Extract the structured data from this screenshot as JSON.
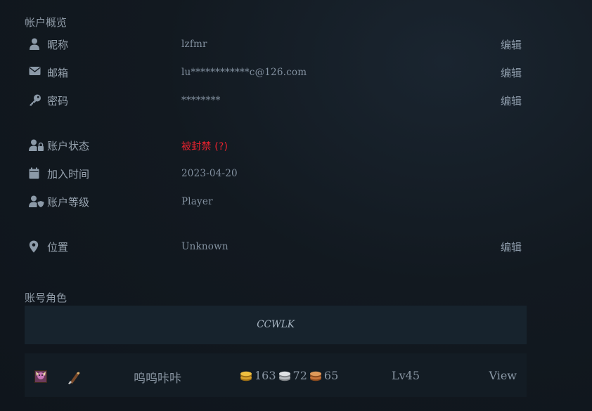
{
  "overview": {
    "title": "帐户概览",
    "rows": {
      "nickname": {
        "label": "昵称",
        "value": "lzfmr",
        "edit": "编辑"
      },
      "email": {
        "label": "邮箱",
        "value": "lu************c@126.com",
        "edit": "编辑"
      },
      "password": {
        "label": "密码",
        "value": "********",
        "edit": "编辑"
      },
      "status": {
        "label": "账户状态",
        "value": "被封禁 (?)"
      },
      "joined": {
        "label": "加入时间",
        "value": "2023-04-20"
      },
      "level": {
        "label": "账户等级",
        "value": "Player"
      },
      "location": {
        "label": "位置",
        "value": "Unknown",
        "edit": "编辑"
      }
    }
  },
  "characters": {
    "title": "账号角色",
    "realm": "CCWLK",
    "list": [
      {
        "name": "呜呜咔咔",
        "gold": "163",
        "silver": "72",
        "copper": "65",
        "level": "Lv45",
        "view": "View"
      }
    ]
  },
  "colors": {
    "banned": "#e8222e",
    "gold": "#d9a02a",
    "silver": "#b8bcc0",
    "copper": "#c8753a"
  }
}
